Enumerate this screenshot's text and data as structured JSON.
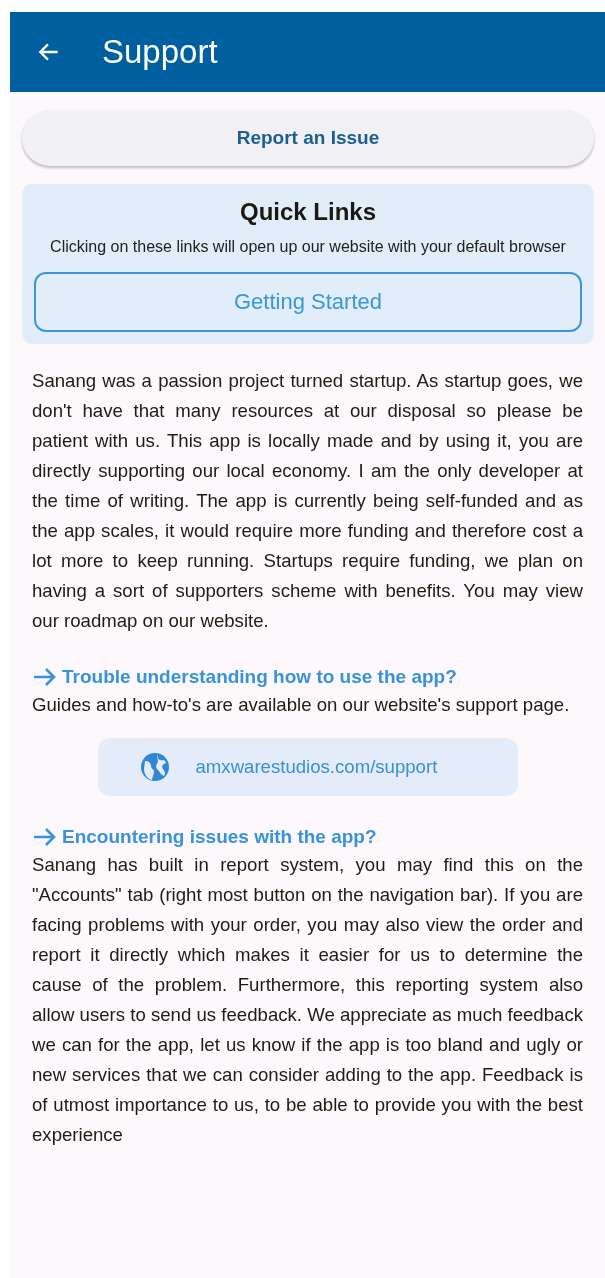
{
  "app_bar": {
    "title": "Support"
  },
  "report_button": {
    "label": "Report an Issue"
  },
  "quick_links": {
    "title": "Quick Links",
    "description": "Clicking on these links will open up our website with your default browser",
    "links": [
      {
        "label": "Getting Started"
      }
    ]
  },
  "intro": "Sanang was a passion project turned startup. As startup goes, we don't have that many resources at our disposal so please be patient with us. This app is locally made and by using it, you are directly supporting our local economy. I am the only developer at the time of writing. The app is currently being self-funded and as the app scales, it would require more funding and therefore cost a lot more to keep running. Startups require funding, we plan on having a sort of supporters scheme with benefits. You may view our roadmap on our website.",
  "sections": [
    {
      "heading": "Trouble understanding how to use the app?",
      "body": "Guides and how-to's are available on our website's support page.",
      "link": {
        "label": "amxwarestudios.com/support"
      }
    },
    {
      "heading": "Encountering issues with the app?",
      "body": "Sanang has built in report system, you may find this on the \"Accounts\" tab (right most button on the navigation bar). If you are facing problems with your order, you may also view the order and report it directly which makes it easier for us to determine the cause of the problem. Furthermore, this reporting system also allow users to send us feedback. We appreciate as much feedback we can for the app, let us know if the app is too bland and ugly or new services that we can consider adding to the app. Feedback is of utmost importance to us, to be able to provide you with the best experience"
    }
  ]
}
